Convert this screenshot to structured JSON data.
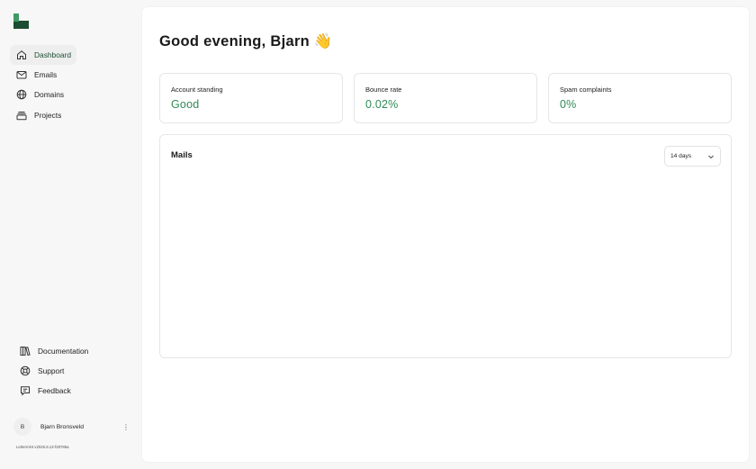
{
  "app": {
    "logo_icon": "letter-l-block-icon",
    "accent": "#1b4d32",
    "value_color": "#2e8b57",
    "version": "Lettermint v2025.8.13-f28786a"
  },
  "sidebar": {
    "items": [
      {
        "label": "Dashboard",
        "icon": "home-icon",
        "active": true
      },
      {
        "label": "Emails",
        "icon": "mail-icon",
        "active": false
      },
      {
        "label": "Domains",
        "icon": "globe-icon",
        "active": false
      },
      {
        "label": "Projects",
        "icon": "projects-icon",
        "active": false
      }
    ],
    "bottom_items": [
      {
        "label": "Documentation",
        "icon": "books-icon"
      },
      {
        "label": "Support",
        "icon": "lifebuoy-icon"
      },
      {
        "label": "Feedback",
        "icon": "feedback-icon"
      }
    ],
    "user": {
      "initial": "B",
      "name": "Bjarn Bronsveld",
      "menu_icon": "kebab-icon"
    }
  },
  "main": {
    "greeting": "Good evening, Bjarn 👋",
    "stats": [
      {
        "label": "Account standing",
        "value": "Good"
      },
      {
        "label": "Bounce rate",
        "value": "0.02%"
      },
      {
        "label": "Spam complaints",
        "value": "0%"
      }
    ],
    "mails": {
      "title": "Mails",
      "range_selected": "14 days",
      "range_icon": "chevron-down-icon"
    }
  }
}
